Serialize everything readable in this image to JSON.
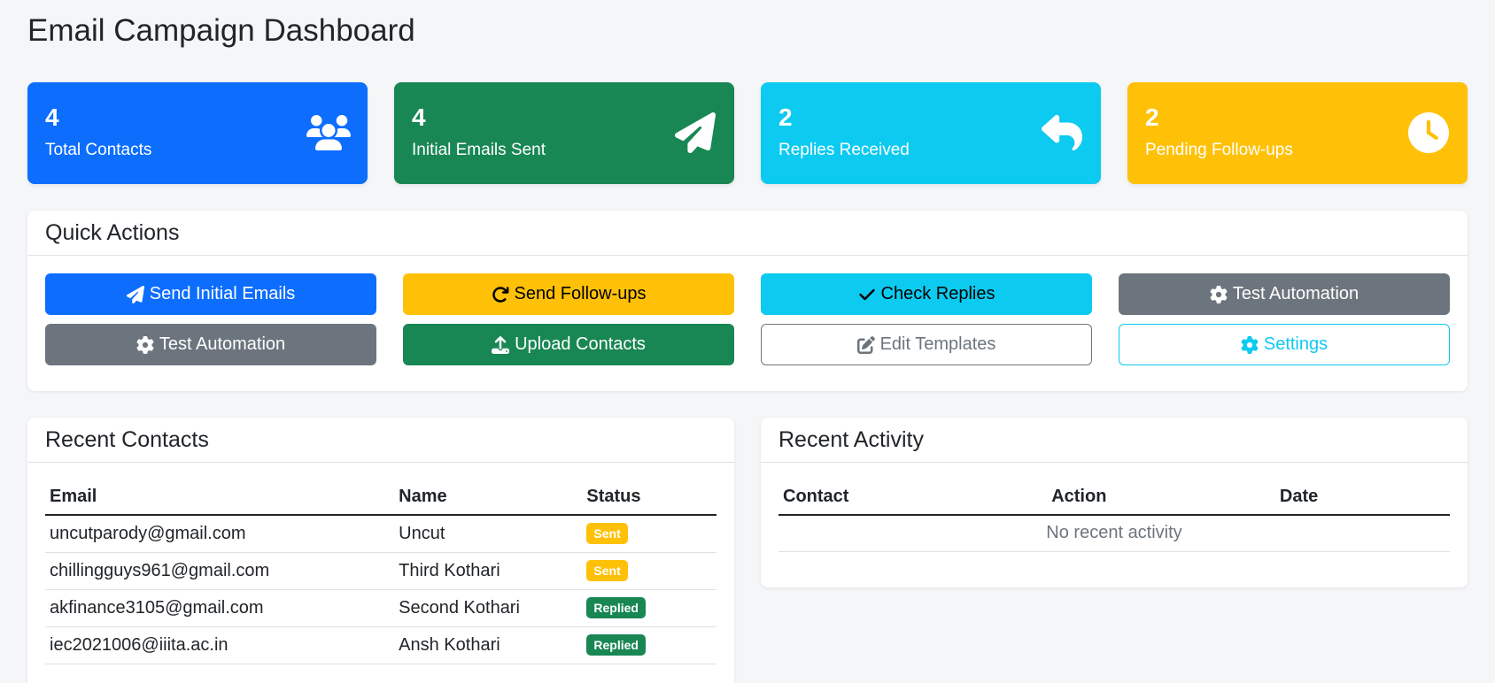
{
  "page": {
    "title": "Email Campaign Dashboard"
  },
  "stats": [
    {
      "value": "4",
      "label": "Total Contacts",
      "color": "#0d6efd",
      "icon": "users-icon"
    },
    {
      "value": "4",
      "label": "Initial Emails Sent",
      "color": "#198754",
      "icon": "paper-plane-icon"
    },
    {
      "value": "2",
      "label": "Replies Received",
      "color": "#0dcaf0",
      "icon": "reply-icon"
    },
    {
      "value": "2",
      "label": "Pending Follow-ups",
      "color": "#ffc107",
      "icon": "clock-icon"
    }
  ],
  "quick_actions": {
    "title": "Quick Actions",
    "buttons": [
      {
        "label": "Send Initial Emails",
        "icon": "paper-plane-icon"
      },
      {
        "label": "Send Follow-ups",
        "icon": "redo-icon"
      },
      {
        "label": "Check Replies",
        "icon": "check-icon"
      },
      {
        "label": "Test Automation",
        "icon": "gear-icon"
      },
      {
        "label": "Test Automation",
        "icon": "gear-icon"
      },
      {
        "label": "Upload Contacts",
        "icon": "upload-icon"
      },
      {
        "label": "Edit Templates",
        "icon": "edit-icon"
      },
      {
        "label": "Settings",
        "icon": "gear-icon"
      }
    ]
  },
  "recent_contacts": {
    "title": "Recent Contacts",
    "columns": [
      "Email",
      "Name",
      "Status"
    ],
    "rows": [
      {
        "email": "uncutparody@gmail.com",
        "name": "Uncut",
        "status": "Sent"
      },
      {
        "email": "chillingguys961@gmail.com",
        "name": "Third Kothari",
        "status": "Sent"
      },
      {
        "email": "akfinance3105@gmail.com",
        "name": "Second Kothari",
        "status": "Replied"
      },
      {
        "email": "iec2021006@iiita.ac.in",
        "name": "Ansh Kothari",
        "status": "Replied"
      }
    ]
  },
  "recent_activity": {
    "title": "Recent Activity",
    "columns": [
      "Contact",
      "Action",
      "Date"
    ],
    "empty_text": "No recent activity"
  },
  "colors": {
    "sent": "#ffc107",
    "replied": "#198754"
  }
}
